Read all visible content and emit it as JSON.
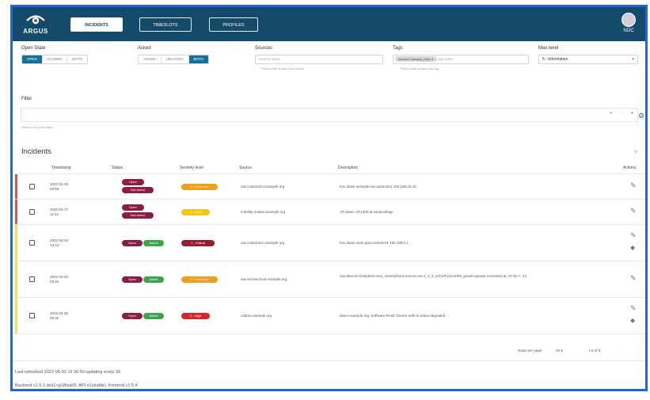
{
  "app": {
    "logo_text": "ARGUS",
    "user": "NOC",
    "accent_color": "#154a6b",
    "border_color": "#1f66d8"
  },
  "nav": {
    "tabs": [
      {
        "label": "INCIDENTS",
        "active": true
      },
      {
        "label": "TIMESLOTS",
        "active": false
      },
      {
        "label": "PROFILES",
        "active": false
      }
    ]
  },
  "filters": {
    "open_state": {
      "label": "Open State",
      "options": [
        "OPEN",
        "CLOSED",
        "BOTH"
      ],
      "selected": "OPEN"
    },
    "acked": {
      "label": "Acked",
      "options": [
        "ACKED",
        "UNACKED",
        "BOTH"
      ],
      "selected": "BOTH"
    },
    "sources": {
      "label": "Sources",
      "placeholder": "Source name",
      "help": "Press enter to add new source"
    },
    "tags": {
      "label": "Tags",
      "chip": "service=Campus_Oslo",
      "placeholder": "tag=value",
      "help": "Press enter to add new tag"
    },
    "max_level": {
      "label": "Max level",
      "value": "5 - Information"
    },
    "filter": {
      "label": "Filter",
      "help": "Select from your filters"
    }
  },
  "incidents": {
    "title": "Incidents",
    "columns": [
      "Timestamp",
      "Status",
      "Severity level",
      "Source",
      "Description",
      "Actions"
    ],
    "rows": [
      {
        "date": "2022-04-28",
        "time": "09:56",
        "status": [
          "Open",
          "Not acked"
        ],
        "status_colors": [
          "#8c1d3e",
          "#8c1d3e"
        ],
        "severity": "4 - Moderate",
        "severity_color": "#f39c1a",
        "source": "nav.customer1.example.org",
        "description": "box down example-sw.customer1 192.168.42.42",
        "bar_color": "#d9534f",
        "tag_icon": false
      },
      {
        "date": "2022-04-27",
        "time": "11:42",
        "status": [
          "Open",
          "Not acked"
        ],
        "status_colors": [
          "#8c1d3e",
          "#8c1d3e"
        ],
        "severity": "3 - Low",
        "severity_color": "#f5c518",
        "source": "mobility-master.example.org",
        "description": "AP down: AP1303 at somecollege",
        "bar_color": "#d9534f",
        "tag_icon": false
      },
      {
        "date": "2022-04-03",
        "time": "13:12",
        "status": [
          "Open",
          "Acked"
        ],
        "status_colors": [
          "#8c1d3e",
          "#3aa64a"
        ],
        "severity": "1 - Critical",
        "severity_color": "#9b1b30",
        "source": "nav.customer1.example.org",
        "description": "box down main-gsw.customer1 192.168.0.1",
        "bar_color": "#f3e060",
        "tag_icon": true
      },
      {
        "date": "2022-04-02",
        "time": "09:32",
        "status": [
          "Open",
          "Acked"
        ],
        "status_colors": [
          "#8c1d3e",
          "#3aa64a"
        ],
        "severity": "4 - Moderate",
        "severity_color": "#f39c1a",
        "source": "nav.someschool.example.org",
        "description": "nav.devices.hotsphere-sw1_someschool.sensors.sw-1_2_2_snCtrlFLtxHmRx_powerrxpower exceeded at -37.32 < -14",
        "bar_color": "#f3e060",
        "tag_icon": false
      },
      {
        "date": "2022-04-02",
        "time": "08:32",
        "status": [
          "Open",
          "Acked"
        ],
        "status_colors": [
          "#8c1d3e",
          "#3aa64a"
        ],
        "severity": "2 - High",
        "severity_color": "#d6262b",
        "source": "zabbix.example.org",
        "description": "dsum.example.org: Software RAID: Device md0 is active.degraded",
        "bar_color": "#f3e060",
        "tag_icon": true
      }
    ]
  },
  "pagination": {
    "rows_per_page_label": "Rows per page:",
    "rows_per_page": "25",
    "range": "1-5 of 5"
  },
  "status_bar": {
    "refreshed": "Last refreshed 2022-06-03 16:36:50 updating every 30",
    "versions": "Backend v1.5.1.dev1+g18faa05, API v1(stable), frontend v1.5.4"
  }
}
